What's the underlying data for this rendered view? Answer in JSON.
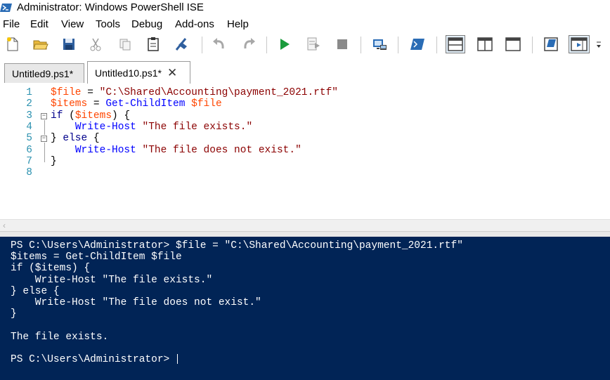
{
  "window": {
    "title": "Administrator: Windows PowerShell ISE",
    "app_icon": "powershell-icon"
  },
  "menu": [
    "File",
    "Edit",
    "View",
    "Tools",
    "Debug",
    "Add-ons",
    "Help"
  ],
  "toolbar": {
    "icons": [
      "new-file-icon",
      "open-file-icon",
      "save-icon",
      "cut-icon",
      "copy-icon",
      "paste-icon",
      "clear-console-icon",
      "undo-icon",
      "redo-icon",
      "run-script-icon",
      "run-selection-icon",
      "stop-icon",
      "remote-powershell-icon",
      "start-powershell-exe-icon",
      "script-pane-top-icon",
      "script-pane-right-icon",
      "script-pane-maximized-icon",
      "show-command-icon",
      "show-command-addon-icon",
      "toolbar-overflow-icon"
    ]
  },
  "tabs": [
    {
      "label": "Untitled9.ps1*",
      "active": false
    },
    {
      "label": "Untitled10.ps1*",
      "active": true
    }
  ],
  "editor": {
    "line_numbers": [
      "1",
      "2",
      "3",
      "4",
      "5",
      "6",
      "7",
      "8"
    ],
    "lines": [
      [
        {
          "t": "$file",
          "c": "var"
        },
        {
          "t": " = ",
          "c": "plain"
        },
        {
          "t": "\"C:\\Shared\\Accounting\\payment_2021.rtf\"",
          "c": "str"
        }
      ],
      [
        {
          "t": "$items",
          "c": "var"
        },
        {
          "t": " = ",
          "c": "plain"
        },
        {
          "t": "Get-ChildItem",
          "c": "cmd"
        },
        {
          "t": " ",
          "c": "plain"
        },
        {
          "t": "$file",
          "c": "var"
        }
      ],
      [
        {
          "t": "if",
          "c": "kw"
        },
        {
          "t": " (",
          "c": "plain"
        },
        {
          "t": "$items",
          "c": "var"
        },
        {
          "t": ") {",
          "c": "plain"
        }
      ],
      [
        {
          "t": "    ",
          "c": "plain"
        },
        {
          "t": "Write-Host",
          "c": "cmd"
        },
        {
          "t": " ",
          "c": "plain"
        },
        {
          "t": "\"The file exists.\"",
          "c": "str"
        }
      ],
      [
        {
          "t": "} ",
          "c": "plain"
        },
        {
          "t": "else",
          "c": "kw"
        },
        {
          "t": " {",
          "c": "plain"
        }
      ],
      [
        {
          "t": "    ",
          "c": "plain"
        },
        {
          "t": "Write-Host",
          "c": "cmd"
        },
        {
          "t": " ",
          "c": "plain"
        },
        {
          "t": "\"The file does not exist.\"",
          "c": "str"
        }
      ],
      [
        {
          "t": "}",
          "c": "plain"
        }
      ],
      []
    ]
  },
  "console": {
    "lines": [
      "PS C:\\Users\\Administrator> $file = \"C:\\Shared\\Accounting\\payment_2021.rtf\"",
      "$items = Get-ChildItem $file",
      "if ($items) {",
      "    Write-Host \"The file exists.\"",
      "} else {",
      "    Write-Host \"The file does not exist.\"",
      "}",
      "",
      "The file exists.",
      "",
      "PS C:\\Users\\Administrator> "
    ]
  },
  "colors": {
    "console_bg": "#012456",
    "variable": "#ff4500",
    "string": "#8b0000",
    "cmdlet": "#0000ff",
    "keyword": "#00008b",
    "line_number": "#2b91af"
  }
}
